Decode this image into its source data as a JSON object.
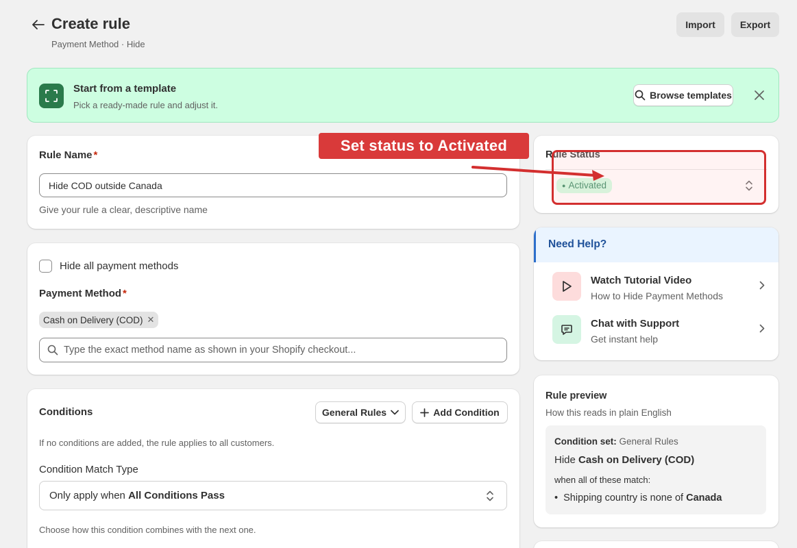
{
  "header": {
    "title": "Create rule",
    "subtitle": "Payment Method · Hide",
    "import_label": "Import",
    "export_label": "Export"
  },
  "banner": {
    "title": "Start from a template",
    "subtitle": "Pick a ready-made rule and adjust it.",
    "browse_label": "Browse templates"
  },
  "rule_name": {
    "label": "Rule Name",
    "required_mark": "*",
    "value": "Hide COD outside Canada",
    "help": "Give your rule a clear, descriptive name"
  },
  "payment": {
    "hide_all_label": "Hide all payment methods",
    "hide_all_checked": false,
    "method_label": "Payment Method",
    "required_mark": "*",
    "selected_tags": [
      "Cash on Delivery (COD)"
    ],
    "search_placeholder": "Type the exact method name as shown in your Shopify checkout..."
  },
  "conditions": {
    "title": "Conditions",
    "set_button": "General Rules",
    "add_button": "Add Condition",
    "note": "If no conditions are added, the rule applies to all customers.",
    "match_label": "Condition Match Type",
    "match_prefix": "Only apply when ",
    "match_value": "All Conditions Pass",
    "combine_note": "Choose how this condition combines with the next one."
  },
  "rule_status": {
    "label": "Rule Status",
    "value": "Activated"
  },
  "help": {
    "title": "Need Help?",
    "items": [
      {
        "title": "Watch Tutorial Video",
        "subtitle": "How to Hide Payment Methods"
      },
      {
        "title": "Chat with Support",
        "subtitle": "Get instant help"
      }
    ]
  },
  "preview": {
    "title": "Rule preview",
    "subtitle": "How this reads in plain English",
    "condition_set_label": "Condition set:",
    "condition_set_value": "General Rules",
    "hide_prefix": "Hide ",
    "hide_value": "Cash on Delivery (COD)",
    "when_text": "when all of these match:",
    "bullet_prefix": "Shipping country is none of ",
    "bullet_value": "Canada"
  },
  "annotation": {
    "label": "Set status to Activated",
    "color": "#d93a3a"
  },
  "colors": {
    "background": "#f1f1f1",
    "banner_bg": "#cdfee1",
    "banner_icon": "#2a7a4b",
    "status_badge_bg": "#cdfee1",
    "status_badge_text": "#29845a",
    "help_header_bg": "#eaf4ff",
    "help_title": "#1f5199",
    "required": "#c5280c"
  },
  "icons": {
    "back": "arrow-left-icon",
    "banner": "focus-frame-icon",
    "browse": "search-icon",
    "close": "close-icon",
    "search": "search-icon",
    "dropdown": "chevron-down-icon",
    "add": "plus-icon",
    "select": "select-arrows-icon",
    "video": "play-icon",
    "chat": "chat-icon",
    "chevron": "chevron-right-icon"
  }
}
